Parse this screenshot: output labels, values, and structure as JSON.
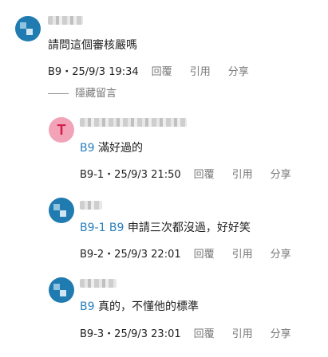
{
  "main_comment": {
    "text": "請問這個審核嚴嗎",
    "floor": "B9",
    "timestamp": "25/9/3 19:34",
    "actions": {
      "reply": "回覆",
      "quote": "引用",
      "share": "分享"
    }
  },
  "hide_replies_label": "隱藏留言",
  "replies": [
    {
      "avatar_letter": "T",
      "avatar_color": "#f2a3b8",
      "mentions": "B9",
      "text": "滿好過的",
      "floor": "B9-1",
      "timestamp": "25/9/3 21:50"
    },
    {
      "avatar_color": "#1f7bb0",
      "mentions": "B9-1 B9",
      "text": "申請三次都沒過，好好笑",
      "floor": "B9-2",
      "timestamp": "25/9/3 22:01"
    },
    {
      "avatar_color": "#1f7bb0",
      "mentions": "B9",
      "text": "真的，不懂他的標準",
      "floor": "B9-3",
      "timestamp": "25/9/3 23:01"
    }
  ],
  "separator": "・",
  "colors": {
    "link": "#2a7fbf",
    "muted": "#777777"
  }
}
